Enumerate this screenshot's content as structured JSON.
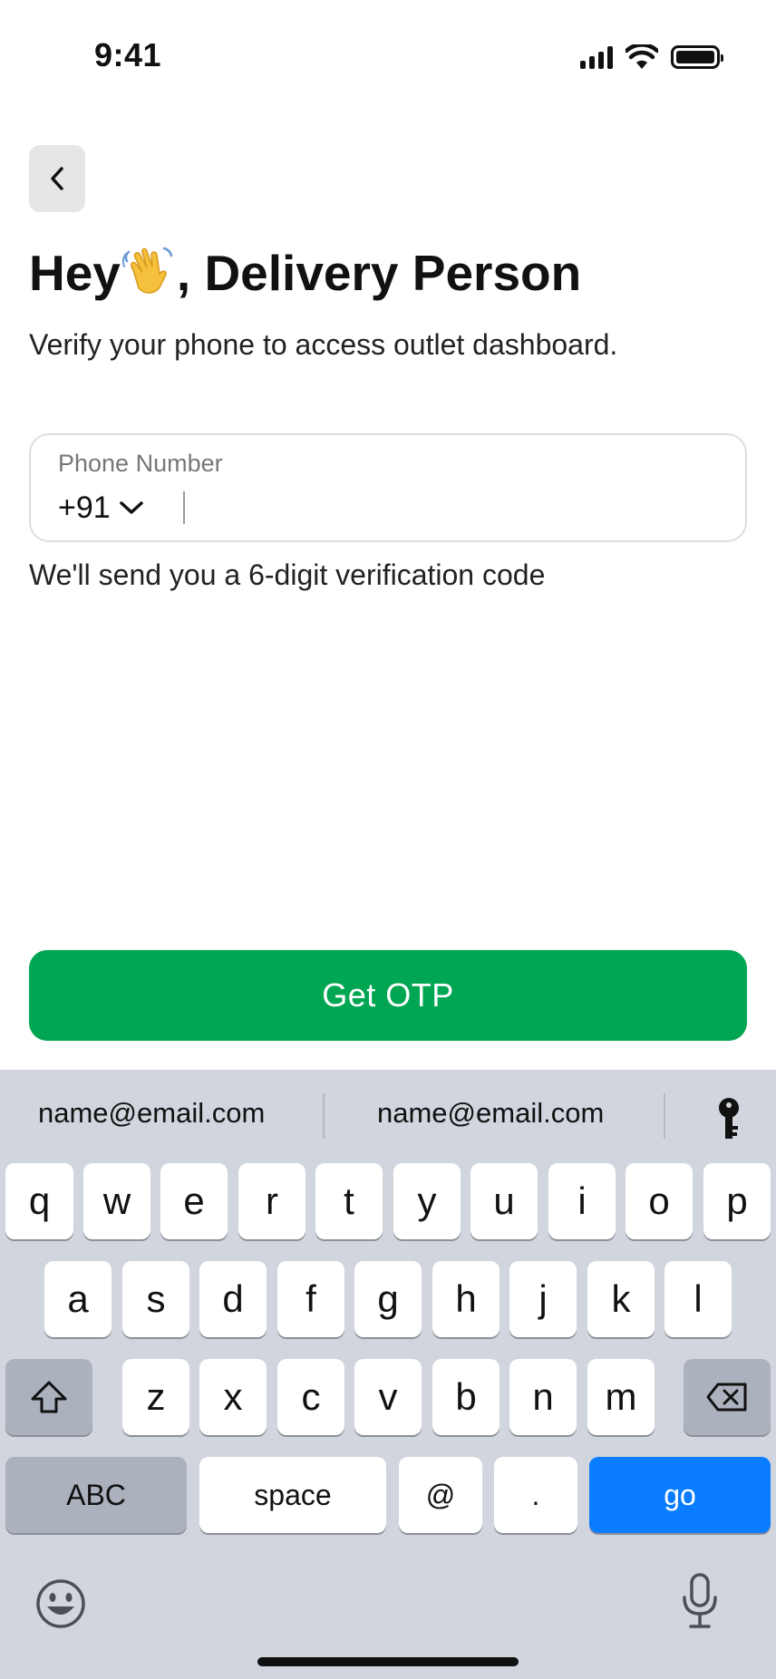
{
  "status_bar": {
    "time": "9:41"
  },
  "header": {
    "title_before_emoji": "Hey",
    "title_emoji_icon": "waving-hand-icon",
    "title_after_emoji": ", Delivery Person",
    "subtitle": "Verify your phone to access outlet dashboard."
  },
  "phone_field": {
    "label": "Phone Number",
    "country_code": "+91",
    "value": "",
    "placeholder": ""
  },
  "helper_text": "We'll send you a 6-digit verification code",
  "primary_button": {
    "label": "Get OTP",
    "color": "#00a651"
  },
  "keyboard": {
    "suggestions": [
      "name@email.com",
      "name@email.com"
    ],
    "row1": [
      "q",
      "w",
      "e",
      "r",
      "t",
      "y",
      "u",
      "i",
      "o",
      "p"
    ],
    "row2": [
      "a",
      "s",
      "d",
      "f",
      "g",
      "h",
      "j",
      "k",
      "l"
    ],
    "row3": [
      "z",
      "x",
      "c",
      "v",
      "b",
      "n",
      "m"
    ],
    "row4": {
      "abc": "ABC",
      "space": "space",
      "at": "@",
      "dot": ".",
      "go": "go"
    },
    "go_color": "#0a7cff"
  }
}
